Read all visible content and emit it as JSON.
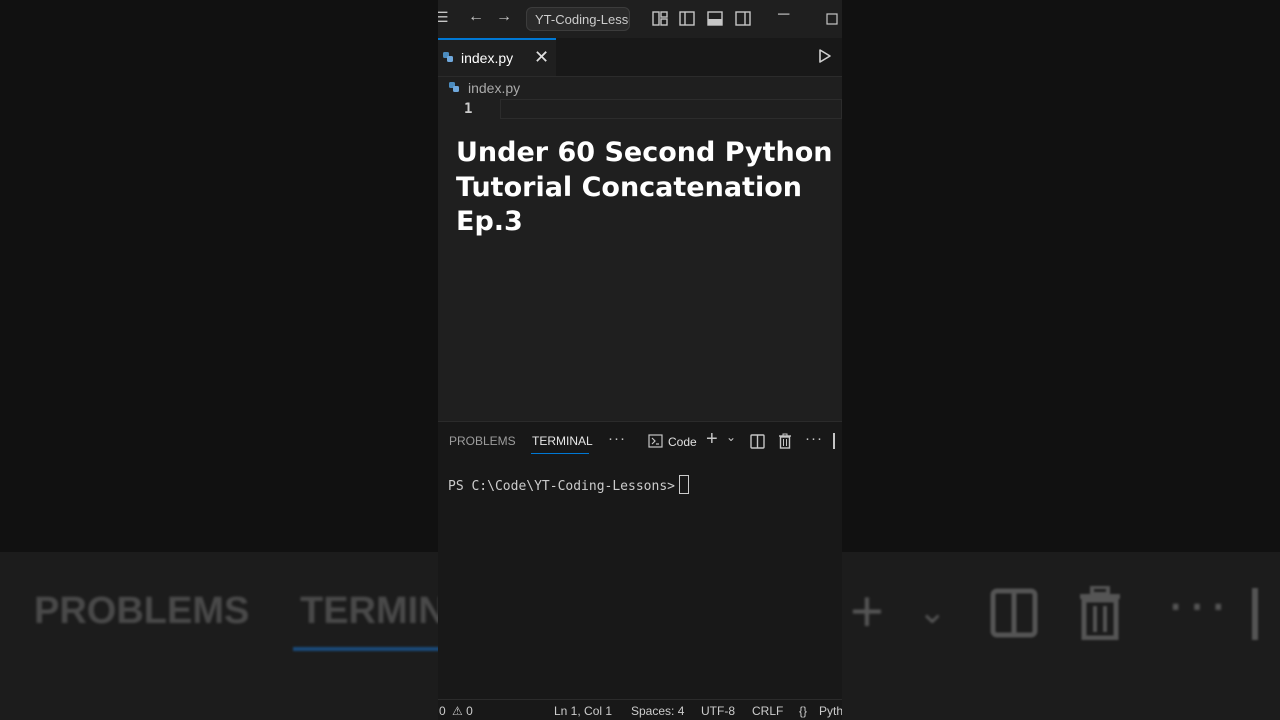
{
  "window": {
    "search_text": "YT-Coding-Lessons",
    "tab_label": "index.py",
    "breadcrumb": "index.py",
    "line_number": "1"
  },
  "overlay": {
    "title_line1": "Under 60 Second Python",
    "title_line2": "Tutorial Concatenation",
    "title_line3": "Ep.3"
  },
  "panel": {
    "tabs": [
      "PROBLEMS",
      "TERMINAL"
    ],
    "active_tab": "TERMINAL",
    "terminal_profile": "Code",
    "terminal_prompt": "PS C:\\Code\\YT-Coding-Lessons>"
  },
  "status_bar": {
    "errors": "0",
    "warnings": "0",
    "position": "Ln 1, Col 1",
    "spaces": "Spaces: 4",
    "encoding": "UTF-8",
    "eol": "CRLF",
    "braces": "{}",
    "language": "Python"
  },
  "background": {
    "problems_label": "PROBLEMS",
    "terminal_label": "TERMINAL"
  },
  "colors": {
    "accent": "#0078d4",
    "editor_bg": "#1f1f1f",
    "panel_bg": "#181818"
  }
}
